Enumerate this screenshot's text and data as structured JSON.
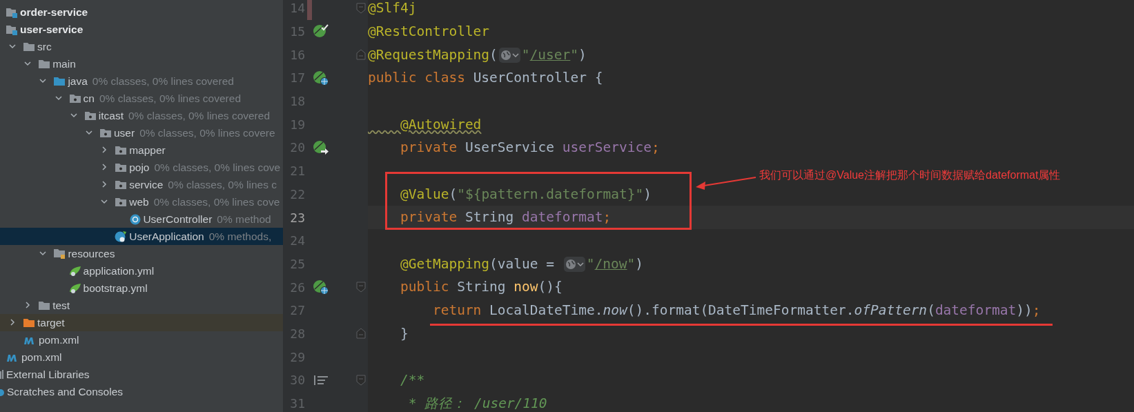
{
  "project_tree": [
    {
      "label": "order-service",
      "kind": "module",
      "selected": false
    },
    {
      "label": "user-service",
      "kind": "module",
      "selected": false,
      "children": [
        {
          "label": "src",
          "kind": "folder",
          "expanded": true,
          "selected": false,
          "children": [
            {
              "label": "main",
              "kind": "folder",
              "expanded": true,
              "selected": false,
              "children": [
                {
                  "label": "java",
                  "hint": "0% classes, 0% lines covered",
                  "kind": "source_folder",
                  "expanded": true,
                  "selected": false,
                  "children": [
                    {
                      "label": "cn",
                      "hint": "0% classes, 0% lines covered",
                      "kind": "package",
                      "expanded": true,
                      "selected": false,
                      "children": [
                        {
                          "label": "itcast",
                          "hint": "0% classes, 0% lines covered",
                          "kind": "package",
                          "expanded": true,
                          "selected": false,
                          "children": [
                            {
                              "label": "user",
                              "hint": "0% classes, 0% lines covere",
                              "kind": "package",
                              "expanded": true,
                              "selected": false,
                              "children": [
                                {
                                  "label": "mapper",
                                  "kind": "package",
                                  "expanded": false,
                                  "selected": false
                                },
                                {
                                  "label": "pojo",
                                  "hint": "0% classes, 0% lines cove",
                                  "kind": "package",
                                  "expanded": false,
                                  "selected": false
                                },
                                {
                                  "label": "service",
                                  "hint": "0% classes, 0% lines c",
                                  "kind": "package",
                                  "expanded": false,
                                  "selected": false
                                },
                                {
                                  "label": "web",
                                  "hint": "0% classes, 0% lines cove",
                                  "kind": "package",
                                  "expanded": true,
                                  "selected": false,
                                  "children": [
                                    {
                                      "label": "UserController",
                                      "hint": "0% method",
                                      "kind": "class",
                                      "selected": false
                                    }
                                  ]
                                },
                                {
                                  "label": "UserApplication",
                                  "hint": "0% methods,",
                                  "kind": "spring_app",
                                  "selected": true
                                }
                              ]
                            }
                          ]
                        }
                      ]
                    }
                  ]
                },
                {
                  "label": "resources",
                  "kind": "resources_folder",
                  "expanded": true,
                  "selected": false,
                  "children": [
                    {
                      "label": "application.yml",
                      "kind": "spring_yml",
                      "selected": false
                    },
                    {
                      "label": "bootstrap.yml",
                      "kind": "spring_yml",
                      "selected": false
                    }
                  ]
                }
              ]
            },
            {
              "label": "test",
              "kind": "folder",
              "expanded": false,
              "selected": false
            }
          ]
        },
        {
          "label": "target",
          "kind": "excluded_folder",
          "expanded": false,
          "selected": false
        },
        {
          "label": "pom.xml",
          "kind": "maven",
          "selected": false
        }
      ]
    },
    {
      "label": "pom.xml",
      "kind": "maven",
      "selected": false
    },
    {
      "label": "External Libraries",
      "kind": "libraries",
      "selected": false
    },
    {
      "label": "Scratches and Consoles",
      "kind": "scratches",
      "selected": false
    }
  ],
  "editor": {
    "lines": [
      {
        "number": "14",
        "changed": true,
        "current": false,
        "marks": [
          {
            "kind": "fold_start"
          }
        ],
        "tokens": [
          {
            "kind": "annotation",
            "text": "@Slf4j"
          }
        ]
      },
      {
        "number": "15",
        "changed": false,
        "current": false,
        "marks": [
          {
            "kind": "bean_check"
          }
        ],
        "tokens": [
          {
            "kind": "annotation",
            "text": "@RestController"
          }
        ]
      },
      {
        "number": "16",
        "changed": false,
        "current": false,
        "marks": [
          {
            "kind": "fold_end"
          }
        ],
        "tokens": [
          {
            "kind": "annotation",
            "text": "@RequestMapping"
          },
          {
            "kind": "plain",
            "text": "("
          },
          {
            "kind": "inlay"
          },
          {
            "kind": "string",
            "text": "\""
          },
          {
            "kind": "url",
            "text": "/user"
          },
          {
            "kind": "string",
            "text": "\""
          },
          {
            "kind": "plain",
            "text": ")"
          }
        ]
      },
      {
        "number": "17",
        "changed": false,
        "current": false,
        "marks": [
          {
            "kind": "bean_globe"
          }
        ],
        "tokens": [
          {
            "kind": "keyword",
            "text": "public class "
          },
          {
            "kind": "plain",
            "text": "UserController {"
          }
        ]
      },
      {
        "number": "18",
        "changed": false,
        "current": false
      },
      {
        "number": "19",
        "changed": false,
        "current": false,
        "tokens": [
          {
            "kind": "warn_annotation",
            "text": "    @Autowired"
          }
        ]
      },
      {
        "number": "20",
        "changed": false,
        "current": false,
        "marks": [
          {
            "kind": "bean_arrow"
          }
        ],
        "tokens": [
          {
            "kind": "keyword",
            "text": "    private "
          },
          {
            "kind": "plain",
            "text": "UserService "
          },
          {
            "kind": "field",
            "text": "userService"
          },
          {
            "kind": "keyword",
            "text": ";"
          }
        ]
      },
      {
        "number": "21",
        "changed": false,
        "current": false
      },
      {
        "number": "22",
        "changed": false,
        "current": false,
        "tokens": [
          {
            "kind": "annotation",
            "text": "    @Value"
          },
          {
            "kind": "plain",
            "text": "("
          },
          {
            "kind": "string",
            "text": "\"${pattern.dateformat}\""
          },
          {
            "kind": "plain",
            "text": ")"
          }
        ]
      },
      {
        "number": "23",
        "changed": false,
        "current": true,
        "tokens": [
          {
            "kind": "keyword",
            "text": "    private "
          },
          {
            "kind": "plain",
            "text": "String "
          },
          {
            "kind": "field",
            "text": "dateformat"
          },
          {
            "kind": "keyword",
            "text": ";"
          }
        ]
      },
      {
        "number": "24",
        "changed": false,
        "current": false
      },
      {
        "number": "25",
        "changed": false,
        "current": false,
        "tokens": [
          {
            "kind": "annotation",
            "text": "    @GetMapping"
          },
          {
            "kind": "plain",
            "text": "(value = "
          },
          {
            "kind": "inlay"
          },
          {
            "kind": "string",
            "text": "\""
          },
          {
            "kind": "url",
            "text": "/now"
          },
          {
            "kind": "string",
            "text": "\""
          },
          {
            "kind": "plain",
            "text": ")"
          }
        ]
      },
      {
        "number": "26",
        "changed": false,
        "current": false,
        "marks": [
          {
            "kind": "bean_globe"
          },
          {
            "kind": "fold_start"
          }
        ],
        "tokens": [
          {
            "kind": "keyword",
            "text": "    public "
          },
          {
            "kind": "plain",
            "text": "String "
          },
          {
            "kind": "method",
            "text": "now"
          },
          {
            "kind": "plain",
            "text": "(){"
          }
        ]
      },
      {
        "number": "27",
        "changed": false,
        "current": false,
        "tokens": [
          {
            "kind": "keyword",
            "text": "        return "
          },
          {
            "kind": "plain",
            "text": "LocalDateTime."
          },
          {
            "kind": "static",
            "text": "now"
          },
          {
            "kind": "plain",
            "text": "().format(DateTimeFormatter."
          },
          {
            "kind": "static",
            "text": "ofPattern"
          },
          {
            "kind": "plain",
            "text": "("
          },
          {
            "kind": "field",
            "text": "dateformat"
          },
          {
            "kind": "plain",
            "text": "))"
          },
          {
            "kind": "keyword",
            "text": ";"
          }
        ]
      },
      {
        "number": "28",
        "changed": false,
        "current": false,
        "marks": [
          {
            "kind": "fold_end"
          }
        ],
        "tokens": [
          {
            "kind": "plain",
            "text": "    }"
          }
        ]
      },
      {
        "number": "29",
        "changed": false,
        "current": false
      },
      {
        "number": "30",
        "changed": false,
        "current": false,
        "marks": [
          {
            "kind": "javadoc"
          },
          {
            "kind": "fold_start"
          }
        ],
        "tokens": [
          {
            "kind": "comment",
            "text": "    /**"
          }
        ]
      },
      {
        "number": "31",
        "changed": false,
        "current": false,
        "tokens": [
          {
            "kind": "comment",
            "text": "     * 路径： /user/110"
          }
        ]
      }
    ]
  },
  "annotation": {
    "text": "我们可以通过@Value注解把那个时间数据赋给dateformat属性"
  }
}
